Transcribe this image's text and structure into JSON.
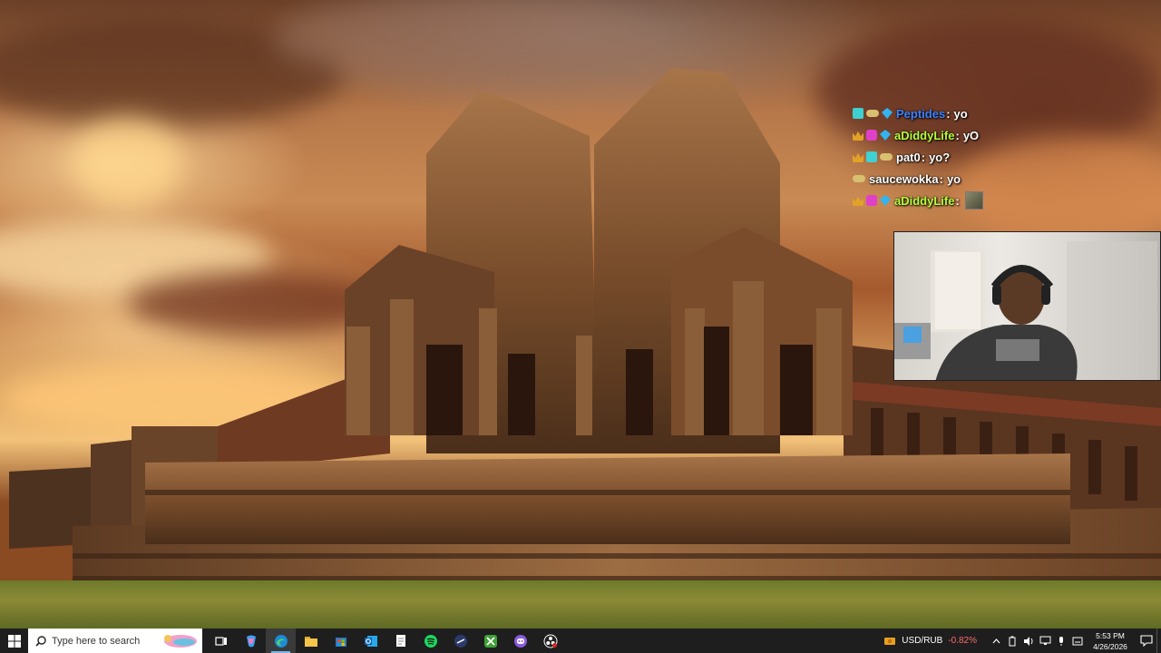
{
  "chat": {
    "messages": [
      {
        "user": "Peptides",
        "user_color": "#3c82ff",
        "text": "yo",
        "badges": [
          "grid",
          "pill",
          "gem"
        ]
      },
      {
        "user": "aDiddyLife",
        "user_color": "#b6ff3a",
        "text": "yO",
        "badges": [
          "crown",
          "pink",
          "gem"
        ]
      },
      {
        "user": "pat0",
        "user_color": "#ffffff",
        "text": "yo?",
        "badges": [
          "crown",
          "grid",
          "pill"
        ]
      },
      {
        "user": "saucewokka",
        "user_color": "#ffffff",
        "text": "yo",
        "badges": [
          "pill"
        ]
      },
      {
        "user": "aDiddyLife",
        "user_color": "#b6ff3a",
        "text": "",
        "badges": [
          "crown",
          "pink",
          "gem"
        ],
        "emote": true
      }
    ],
    "separator": ":"
  },
  "taskbar": {
    "search_placeholder": "Type here to search",
    "apps": [
      {
        "icon": "task-view-icon",
        "active": false
      },
      {
        "icon": "copilot-icon",
        "active": false
      },
      {
        "icon": "edge-icon",
        "active": true
      },
      {
        "icon": "file-explorer-icon",
        "active": false
      },
      {
        "icon": "store-icon",
        "active": false
      },
      {
        "icon": "outlook-icon",
        "active": false
      },
      {
        "icon": "notepad-icon",
        "active": false
      },
      {
        "icon": "spotify-icon",
        "active": false
      },
      {
        "icon": "media-app-icon",
        "active": false
      },
      {
        "icon": "xbox-icon",
        "active": false
      },
      {
        "icon": "discord-icon",
        "active": false
      },
      {
        "icon": "obs-icon",
        "active": false
      }
    ],
    "ticker": {
      "pair": "USD/RUB",
      "change": "-0.82%"
    },
    "clock": {
      "time": "5:53 PM",
      "date": "4/26/2026"
    }
  },
  "colors": {
    "taskbar_bg": "#1e1e1e",
    "accent": "#76b9ed",
    "ticker_negative": "#ff6a6a"
  }
}
